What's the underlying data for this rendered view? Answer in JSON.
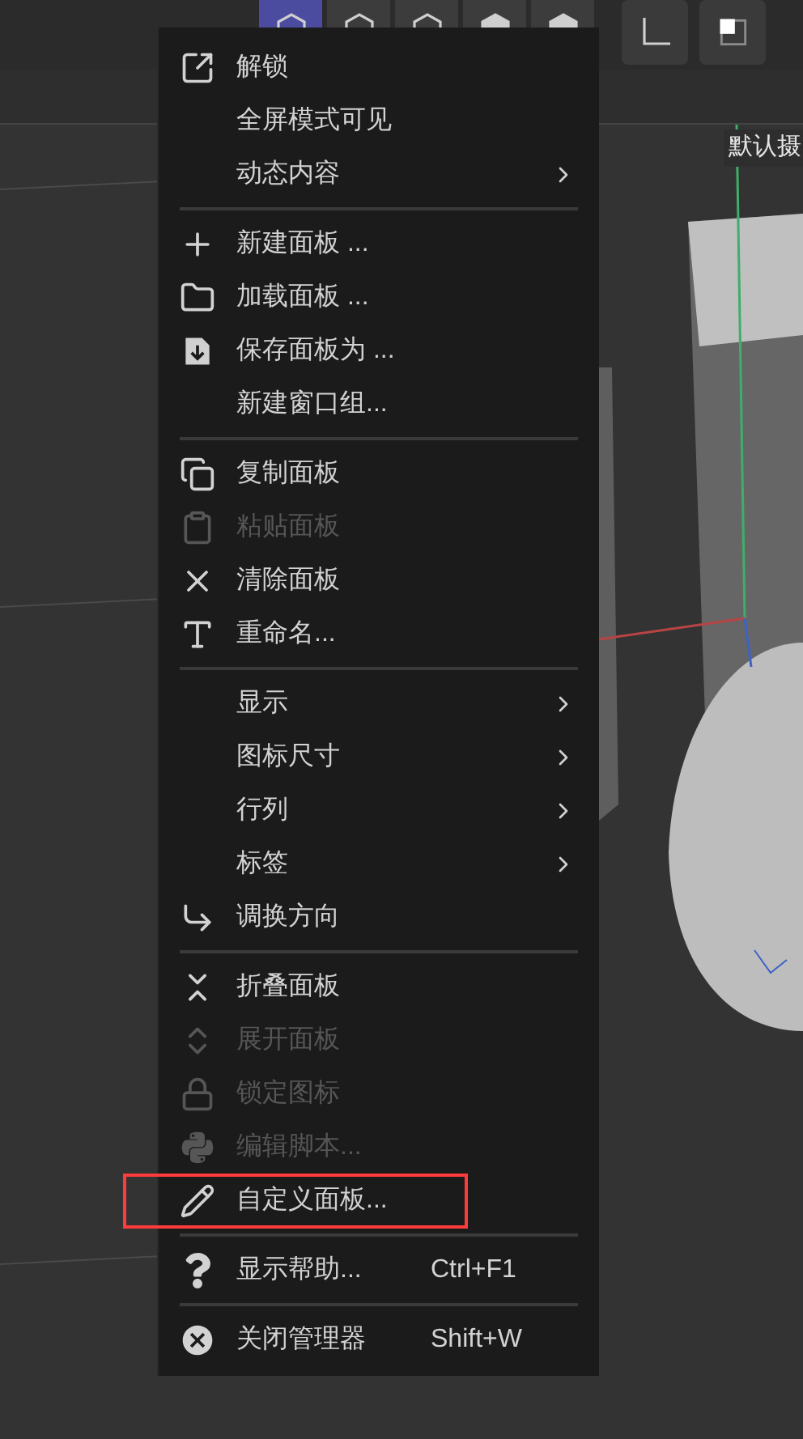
{
  "toolbar": {
    "shading_buttons": [
      {
        "selected": true
      },
      {
        "selected": false
      },
      {
        "selected": false
      },
      {
        "selected": false
      },
      {
        "selected": false
      }
    ]
  },
  "viewport": {
    "camera_label": "默认摄"
  },
  "menu": {
    "items": [
      {
        "kind": "item",
        "label": "解锁",
        "disabled": false
      },
      {
        "kind": "item",
        "label": "全屏模式可见",
        "disabled": false
      },
      {
        "kind": "item",
        "label": "动态内容",
        "disabled": false,
        "submenu": true
      },
      {
        "kind": "separator"
      },
      {
        "kind": "item",
        "label": "新建面板 ...",
        "disabled": false
      },
      {
        "kind": "item",
        "label": "加载面板 ...",
        "disabled": false
      },
      {
        "kind": "item",
        "label": "保存面板为 ...",
        "disabled": false
      },
      {
        "kind": "item",
        "label": "新建窗口组...",
        "disabled": false
      },
      {
        "kind": "separator"
      },
      {
        "kind": "item",
        "label": "复制面板",
        "disabled": false
      },
      {
        "kind": "item",
        "label": "粘贴面板",
        "disabled": true
      },
      {
        "kind": "item",
        "label": "清除面板",
        "disabled": false
      },
      {
        "kind": "item",
        "label": "重命名...",
        "disabled": false
      },
      {
        "kind": "separator"
      },
      {
        "kind": "item",
        "label": "显示",
        "disabled": false,
        "submenu": true
      },
      {
        "kind": "item",
        "label": "图标尺寸",
        "disabled": false,
        "submenu": true
      },
      {
        "kind": "item",
        "label": "行列",
        "disabled": false,
        "submenu": true
      },
      {
        "kind": "item",
        "label": "标签",
        "disabled": false,
        "submenu": true
      },
      {
        "kind": "item",
        "label": "调换方向",
        "disabled": false
      },
      {
        "kind": "separator"
      },
      {
        "kind": "item",
        "label": "折叠面板",
        "disabled": false
      },
      {
        "kind": "item",
        "label": "展开面板",
        "disabled": true
      },
      {
        "kind": "item",
        "label": "锁定图标",
        "disabled": true
      },
      {
        "kind": "item",
        "label": "编辑脚本...",
        "disabled": true
      },
      {
        "kind": "item",
        "label": "自定义面板...",
        "disabled": false,
        "highlighted": true
      },
      {
        "kind": "separator"
      },
      {
        "kind": "item",
        "label": "显示帮助...",
        "disabled": false,
        "shortcut": "Ctrl+F1"
      },
      {
        "kind": "separator"
      },
      {
        "kind": "item",
        "label": "关闭管理器",
        "disabled": false,
        "shortcut": "Shift+W"
      }
    ]
  }
}
